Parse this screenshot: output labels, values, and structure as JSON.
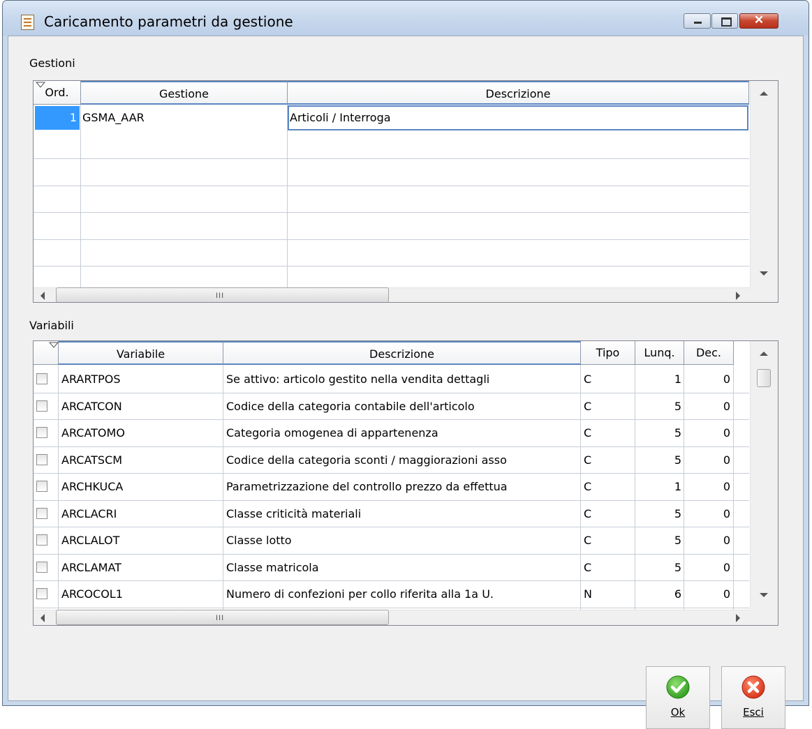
{
  "window": {
    "title": "Caricamento parametri da gestione",
    "close_glyph": "✕"
  },
  "gestioni": {
    "label": "Gestioni",
    "columns": [
      "Ord.",
      "Gestione",
      "Descrizione"
    ],
    "rows": [
      {
        "ord": "1",
        "gestione": "GSMA_AAR",
        "descrizione": "Articoli / Interroga"
      }
    ],
    "hscroll_grip": "III"
  },
  "variabili": {
    "label": "Variabili",
    "columns": [
      "Variabile",
      "Descrizione",
      "Tipo",
      "Lunq.",
      "Dec."
    ],
    "rows": [
      {
        "variabile": "ARARTPOS",
        "descrizione": "Se attivo: articolo gestito nella vendita dettagli",
        "tipo": "C",
        "lung": "1",
        "dec": "0"
      },
      {
        "variabile": "ARCATCON",
        "descrizione": "Codice della categoria contabile dell'articolo",
        "tipo": "C",
        "lung": "5",
        "dec": "0"
      },
      {
        "variabile": "ARCATOMO",
        "descrizione": "Categoria omogenea di appartenenza",
        "tipo": "C",
        "lung": "5",
        "dec": "0"
      },
      {
        "variabile": "ARCATSCM",
        "descrizione": "Codice della categoria sconti / maggiorazioni asso",
        "tipo": "C",
        "lung": "5",
        "dec": "0"
      },
      {
        "variabile": "ARCHKUCA",
        "descrizione": "Parametrizzazione del controllo prezzo da effettua",
        "tipo": "C",
        "lung": "1",
        "dec": "0"
      },
      {
        "variabile": "ARCLACRI",
        "descrizione": "Classe criticità materiali",
        "tipo": "C",
        "lung": "5",
        "dec": "0"
      },
      {
        "variabile": "ARCLALOT",
        "descrizione": "Classe lotto",
        "tipo": "C",
        "lung": "5",
        "dec": "0"
      },
      {
        "variabile": "ARCLAMAT",
        "descrizione": "Classe matricola",
        "tipo": "C",
        "lung": "5",
        "dec": "0"
      },
      {
        "variabile": "ARCOCOL1",
        "descrizione": "Numero di confezioni per collo riferita alla 1a U.",
        "tipo": "N",
        "lung": "6",
        "dec": "0"
      }
    ],
    "hscroll_grip": "III"
  },
  "buttons": {
    "ok": {
      "label": "Ok",
      "icon": "check-icon",
      "color": "#3aa829"
    },
    "esci": {
      "label": "Esci",
      "icon": "close-icon",
      "color": "#e0442a"
    }
  },
  "colors": {
    "selection": "#3399ff",
    "title_bar": "#c6d7ec"
  }
}
